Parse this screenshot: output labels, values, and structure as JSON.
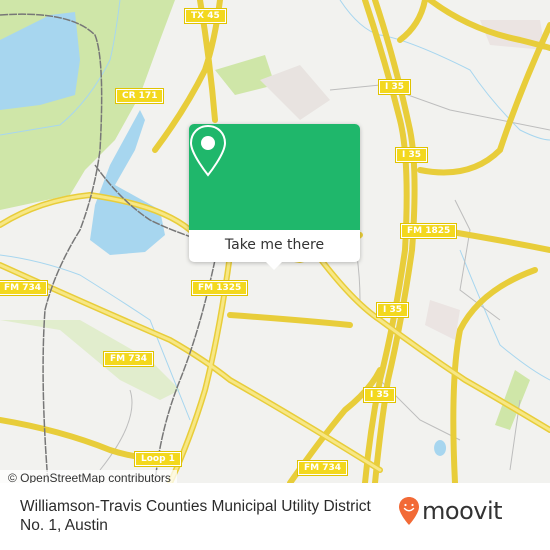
{
  "map": {
    "road_labels": [
      {
        "id": "tx45",
        "text": "TX 45"
      },
      {
        "id": "cr171",
        "text": "CR 171"
      },
      {
        "id": "i35-a",
        "text": "I 35"
      },
      {
        "id": "i35-b",
        "text": "I 35"
      },
      {
        "id": "fm1825",
        "text": "FM 1825"
      },
      {
        "id": "fm734-a",
        "text": "FM 734"
      },
      {
        "id": "fm1325",
        "text": "FM 1325"
      },
      {
        "id": "i35-c",
        "text": "I 35"
      },
      {
        "id": "fm734-b",
        "text": "FM 734"
      },
      {
        "id": "i35-d",
        "text": "I 35"
      },
      {
        "id": "loop1",
        "text": "Loop 1"
      },
      {
        "id": "fm734-c",
        "text": "FM 734"
      }
    ],
    "attribution": "© OpenStreetMap contributors",
    "colors": {
      "land": "#f2f2ef",
      "park": "#cfe6a8",
      "water": "#a7d6ef",
      "road": "#f5df5a",
      "rail": "#777777"
    }
  },
  "popup": {
    "icon": "map-pin-icon",
    "button_label": "Take me there",
    "color": "#1fb76b"
  },
  "footer": {
    "place_name": "Williamson-Travis Counties Municipal Utility District No. 1, Austin",
    "brand": "moovit",
    "brand_icon": "moovit-smile-pin-icon",
    "brand_color": "#f26a36"
  }
}
